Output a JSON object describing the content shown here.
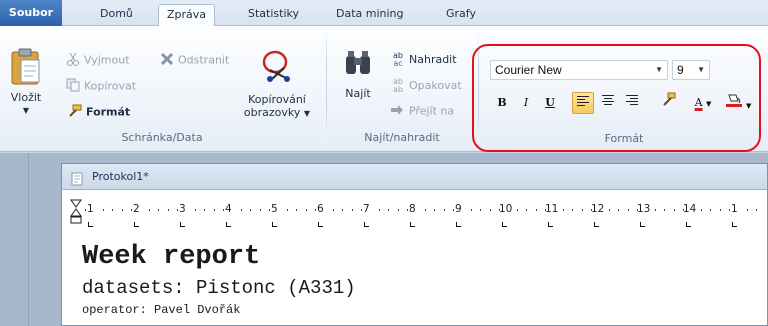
{
  "tabs": [
    "Soubor",
    "Domů",
    "Zpráva",
    "Statistiky",
    "Data mining",
    "Grafy"
  ],
  "ribbon": {
    "clipboard": {
      "paste": "Vložit",
      "cut": "Vyjmout",
      "delete": "Odstranit",
      "copy": "Kopírovat",
      "format_painter": "Formát",
      "screen_copy_line1": "Kopírování",
      "screen_copy_line2": "obrazovky",
      "title": "Schránka/Data"
    },
    "find": {
      "find": "Najít",
      "replace": "Nahradit",
      "repeat": "Opakovat",
      "goto": "Přejít na",
      "title": "Najít/nahradit"
    },
    "format": {
      "font": "Courier New",
      "size": "9",
      "bold": "B",
      "italic": "I",
      "underline": "U",
      "font_color_letter": "A",
      "title": "Formát"
    }
  },
  "document": {
    "title": "Protokol1*",
    "ruler": [
      "1",
      "2",
      "3",
      "4",
      "5",
      "6",
      "7",
      "8",
      "9",
      "10",
      "11",
      "12",
      "13",
      "14",
      "1"
    ],
    "line1": "Week report",
    "line2": "datasets: Pistonc (A331)",
    "line3": "operator: Pavel Dvořák"
  },
  "colors": {
    "file_tab": "#2d62a9",
    "highlight_frame": "#e3101d",
    "active_button": "#f8c95a",
    "font_color_bar": "#d51d1d"
  },
  "icons": [
    "paste-icon",
    "cut-icon",
    "delete-icon",
    "copy-icon",
    "format-painter-icon",
    "screen-capture-icon",
    "binoculars-icon",
    "replace-icon",
    "repeat-icon",
    "goto-icon",
    "align-left-icon",
    "align-center-icon",
    "align-right-icon",
    "clear-format-icon",
    "font-color-icon",
    "highlight-color-icon",
    "document-icon"
  ]
}
